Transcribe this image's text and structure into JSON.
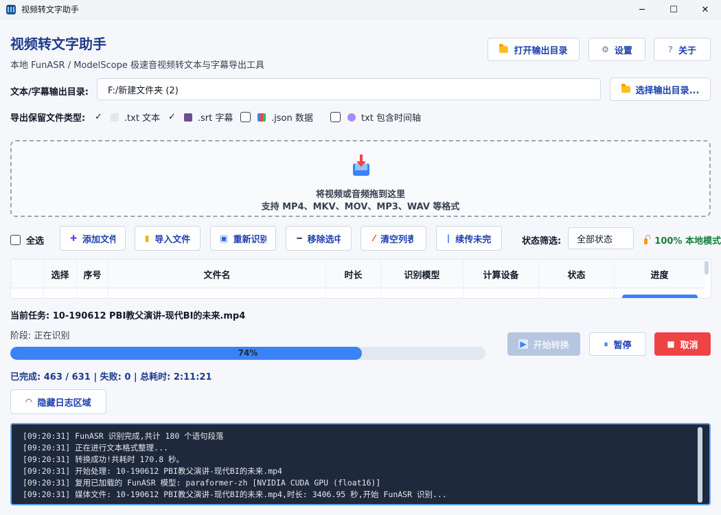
{
  "window": {
    "title": "视频转文字助手",
    "controls": {
      "minimize": "─",
      "maximize": "☐",
      "close": "✕"
    }
  },
  "header": {
    "title": "视频转文字助手",
    "subtitle": "本地 FunASR / ModelScope 极速音视频转文本与字幕导出工具",
    "buttons": {
      "open_output": "打开输出目录",
      "settings": "设置",
      "about": "关于"
    }
  },
  "output": {
    "label": "文本/字幕输出目录:",
    "path": "F:/新建文件夹 (2)",
    "choose_button": "选择输出目录..."
  },
  "export_types": {
    "label": "导出保留文件类型:",
    "items": [
      {
        "label": ".txt 文本",
        "checked": true,
        "icon": "document-icon"
      },
      {
        "label": ".srt 字幕",
        "checked": true,
        "icon": "clapper-icon"
      },
      {
        "label": ".json 数据",
        "checked": false,
        "icon": "chart-icon"
      },
      {
        "label": "txt 包含时间轴",
        "checked": false,
        "icon": "stopwatch-icon"
      }
    ]
  },
  "dropzone": {
    "line1": "将视频或音频拖到这里",
    "line2": "支持 MP4、MKV、MOV、MP3、WAV 等格式"
  },
  "toolbar": {
    "select_all": "全选",
    "add_files": "添加文件",
    "import_files": "导入文件",
    "re_recognize": "重新识别",
    "remove_selected": "移除选中",
    "clear_list": "清空列表",
    "resume_unfinished": "续传未完",
    "filter_label": "状态筛选:",
    "filter_value": "全部状态",
    "local_badge": "100% 本地模式"
  },
  "table": {
    "columns": [
      "选择",
      "序号",
      "文件名",
      "时长",
      "识别模型",
      "计算设备",
      "状态",
      "进度"
    ]
  },
  "task": {
    "current_label": "当前任务: 10-190612 PBI教父演讲-现代BI的未来.mp4",
    "stage": "阶段: 正在识别",
    "progress_percent": 74,
    "progress_text": "74%",
    "stats": "已完成: 463 / 631 | 失败: 0 | 总耗时: 2:11:21"
  },
  "actions": {
    "start": "开始转换",
    "pause": "暂停",
    "cancel": "取消",
    "toggle_log": "隐藏日志区域"
  },
  "log": {
    "lines": [
      "[09:20:31] FunASR 识别完成,共计 180 个语句段落",
      "[09:20:31] 正在进行文本格式整理...",
      "[09:20:31] 转换成功!共耗时 170.8 秒。",
      "[09:20:31] 开始处理: 10-190612 PBI教父演讲-现代BI的未来.mp4",
      "[09:20:31] 复用已加载的 FunASR 模型: paraformer-zh [NVIDIA CUDA GPU (float16)]",
      "[09:20:31] 媒体文件: 10-190612 PBI教父演讲-现代BI的未来.mp4,时长: 3406.95 秒,开始 FunASR 识别..."
    ]
  },
  "colors": {
    "accent": "#3b82f6",
    "title": "#1e3a8a",
    "danger": "#ef4444",
    "disabled": "#b6c6de",
    "log_bg": "#1e293b",
    "success": "#15803d"
  }
}
